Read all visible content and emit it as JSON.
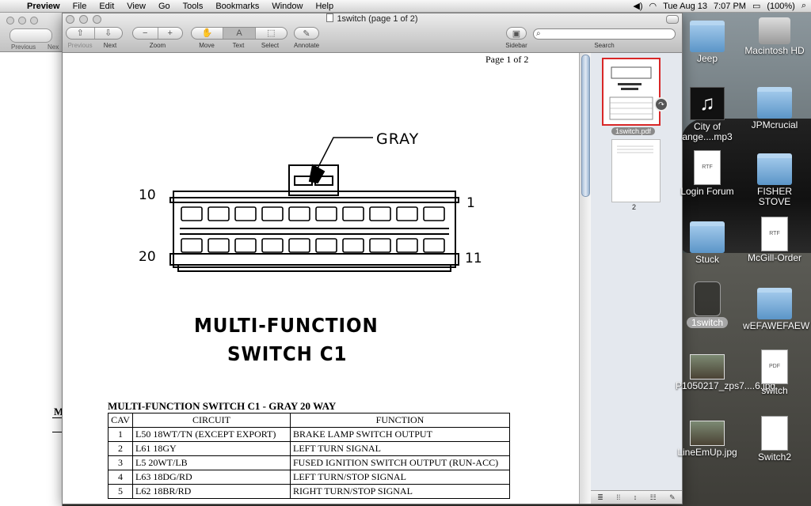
{
  "menubar": {
    "items": [
      "Preview",
      "File",
      "Edit",
      "View",
      "Go",
      "Tools",
      "Bookmarks",
      "Window",
      "Help"
    ],
    "date": "Tue Aug 13",
    "time": "7:07 PM",
    "battery": "(100%)"
  },
  "bg_window": {
    "prev_label": "Previous",
    "next_label": "Nex",
    "fragment": "M"
  },
  "window": {
    "title": "1switch (page 1 of 2)",
    "toolbar": {
      "previous": "Previous",
      "next": "Next",
      "zoom": "Zoom",
      "zoom_out": "−",
      "zoom_in": "+",
      "move": "Move",
      "text": "Text",
      "text_glyph": "A",
      "select": "Select",
      "annotate": "Annotate",
      "sidebar": "Sidebar",
      "search": "Search"
    }
  },
  "document": {
    "page_indicator": "Page 1 of 2",
    "diagram": {
      "color_label": "GRAY",
      "pin_10": "10",
      "pin_1": "1",
      "pin_20": "20",
      "pin_11": "11",
      "title_line1": "MULTI-FUNCTION",
      "title_line2": "SWITCH C1"
    },
    "table_title": "MULTI-FUNCTION SWITCH C1 - GRAY 20 WAY",
    "table": {
      "headers": [
        "CAV",
        "CIRCUIT",
        "FUNCTION"
      ],
      "rows": [
        [
          "1",
          "L50 18WT/TN (EXCEPT EXPORT)",
          "BRAKE LAMP SWITCH OUTPUT"
        ],
        [
          "2",
          "L61 18GY",
          "LEFT TURN SIGNAL"
        ],
        [
          "3",
          "L5 20WT/LB",
          "FUSED IGNITION SWITCH OUTPUT (RUN-ACC)"
        ],
        [
          "4",
          "L63 18DG/RD",
          "LEFT TURN/STOP SIGNAL"
        ],
        [
          "5",
          "L62 18BR/RD",
          "RIGHT TURN/STOP SIGNAL"
        ]
      ]
    }
  },
  "sidebar": {
    "thumb1_label": "1switch.pdf",
    "thumb2_label": "2"
  },
  "desktop": {
    "icons": [
      {
        "label": "Jeep"
      },
      {
        "label": "Macintosh HD"
      },
      {
        "label": "City of ange....mp3"
      },
      {
        "label": "JPMcrucial"
      },
      {
        "label": "Login Forum",
        "kind": "RTF"
      },
      {
        "label": "FISHER STOVE"
      },
      {
        "label": "Stuck"
      },
      {
        "label": "McGill-Order",
        "kind": "RTF"
      },
      {
        "label": "1switch"
      },
      {
        "label": "wEFAWEFAEW"
      },
      {
        "label": "P1050217_zps7....6.jpg"
      },
      {
        "label": "switch",
        "kind": "PDF"
      },
      {
        "label": "LineEmUp.jpg"
      },
      {
        "label": "Switch2"
      }
    ]
  }
}
